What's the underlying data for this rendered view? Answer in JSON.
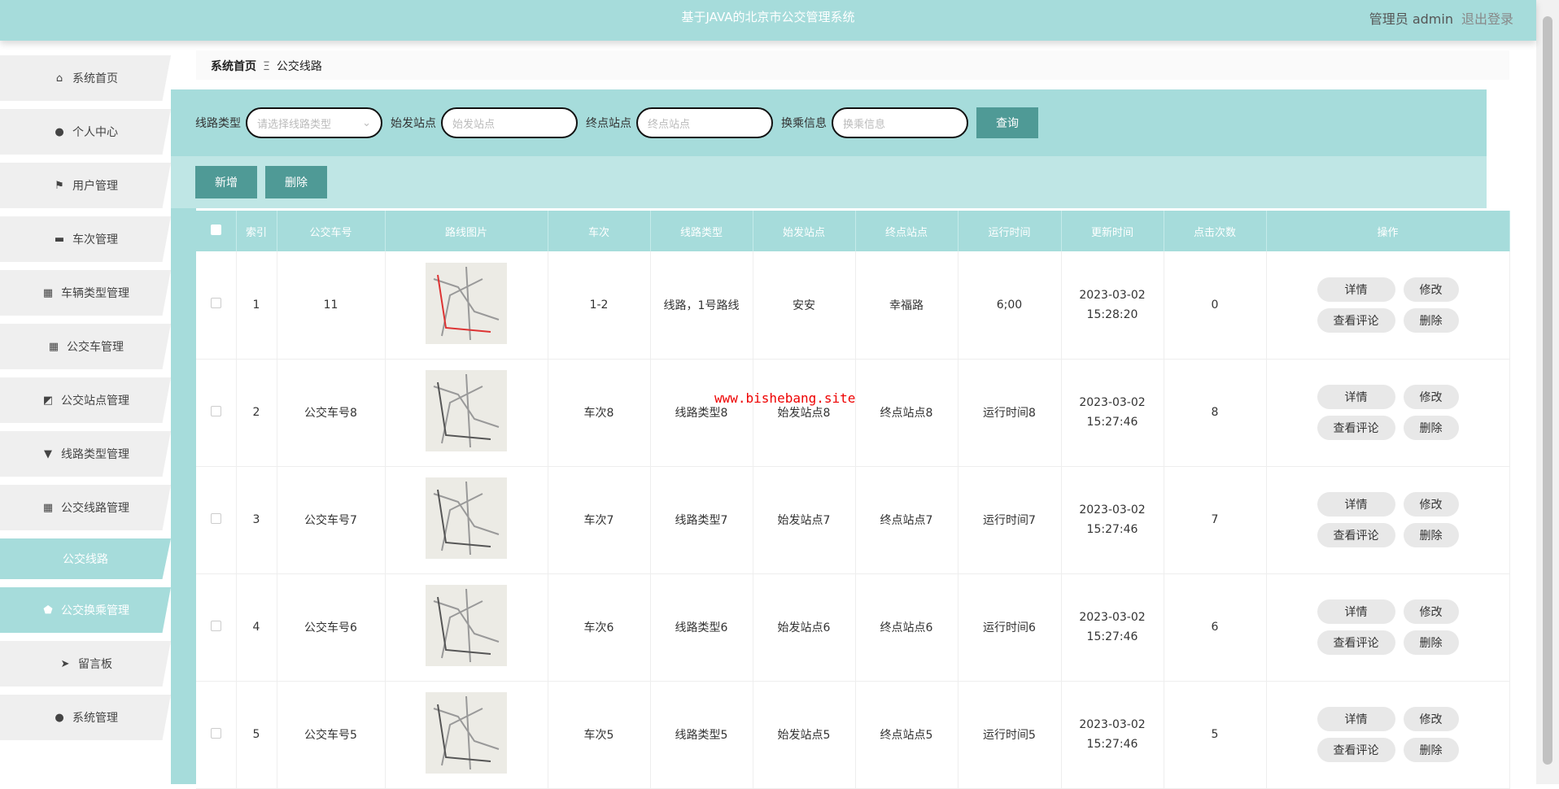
{
  "header": {
    "title": "基于JAVA的北京市公交管理系统",
    "user": "管理员 admin",
    "logout": "退出登录"
  },
  "sidebar": {
    "items": [
      {
        "label": "系统首页",
        "icon": "home-icon",
        "glyph": "⌂"
      },
      {
        "label": "个人中心",
        "icon": "user-icon",
        "glyph": "●"
      },
      {
        "label": "用户管理",
        "icon": "flag-icon",
        "glyph": "⚑"
      },
      {
        "label": "车次管理",
        "icon": "briefcase-icon",
        "glyph": "▬"
      },
      {
        "label": "车辆类型管理",
        "icon": "grid-icon",
        "glyph": "▦"
      },
      {
        "label": "公交车管理",
        "icon": "grid-icon",
        "glyph": "▦"
      },
      {
        "label": "公交站点管理",
        "icon": "chart-icon",
        "glyph": "◩"
      },
      {
        "label": "线路类型管理",
        "icon": "pin-icon",
        "glyph": "▼"
      },
      {
        "label": "公交线路管理",
        "icon": "grid-icon",
        "glyph": "▦"
      },
      {
        "label": "公交线路",
        "icon": "",
        "glyph": ""
      },
      {
        "label": "公交换乘管理",
        "icon": "shield-icon",
        "glyph": "⬟"
      },
      {
        "label": "留言板",
        "icon": "send-icon",
        "glyph": "➤"
      },
      {
        "label": "系统管理",
        "icon": "user-icon",
        "glyph": "●"
      }
    ]
  },
  "breadcrumb": {
    "home": "系统首页",
    "sep": "Ξ",
    "current": "公交线路"
  },
  "search": {
    "type_label": "线路类型",
    "type_placeholder": "请选择线路类型",
    "start_label": "始发站点",
    "start_placeholder": "始发站点",
    "end_label": "终点站点",
    "end_placeholder": "终点站点",
    "transfer_label": "换乘信息",
    "transfer_placeholder": "换乘信息",
    "query": "查询"
  },
  "actions": {
    "add": "新增",
    "delete": "删除"
  },
  "table": {
    "headers": [
      "索引",
      "公交车号",
      "路线图片",
      "车次",
      "线路类型",
      "始发站点",
      "终点站点",
      "运行时间",
      "更新时间",
      "点击次数",
      "操作"
    ],
    "rows": [
      {
        "index": "1",
        "bus": "11",
        "trip": "1-2",
        "type": "线路，1号路线",
        "start": "安安",
        "end": "幸福路",
        "time": "6;00",
        "updated": "2023-03-02 15:28:20",
        "clicks": "0"
      },
      {
        "index": "2",
        "bus": "公交车号8",
        "trip": "车次8",
        "type": "线路类型8",
        "start": "始发站点8",
        "end": "终点站点8",
        "time": "运行时间8",
        "updated": "2023-03-02 15:27:46",
        "clicks": "8"
      },
      {
        "index": "3",
        "bus": "公交车号7",
        "trip": "车次7",
        "type": "线路类型7",
        "start": "始发站点7",
        "end": "终点站点7",
        "time": "运行时间7",
        "updated": "2023-03-02 15:27:46",
        "clicks": "7"
      },
      {
        "index": "4",
        "bus": "公交车号6",
        "trip": "车次6",
        "type": "线路类型6",
        "start": "始发站点6",
        "end": "终点站点6",
        "time": "运行时间6",
        "updated": "2023-03-02 15:27:46",
        "clicks": "6"
      },
      {
        "index": "5",
        "bus": "公交车号5",
        "trip": "车次5",
        "type": "线路类型5",
        "start": "始发站点5",
        "end": "终点站点5",
        "time": "运行时间5",
        "updated": "2023-03-02 15:27:46",
        "clicks": "5"
      }
    ],
    "ops": {
      "detail": "详情",
      "edit": "修改",
      "comments": "查看评论",
      "delete": "删除"
    }
  },
  "watermark": "www.bishebang.site",
  "colors": {
    "primary": "#a6dcdb",
    "button": "#4f9a96"
  }
}
